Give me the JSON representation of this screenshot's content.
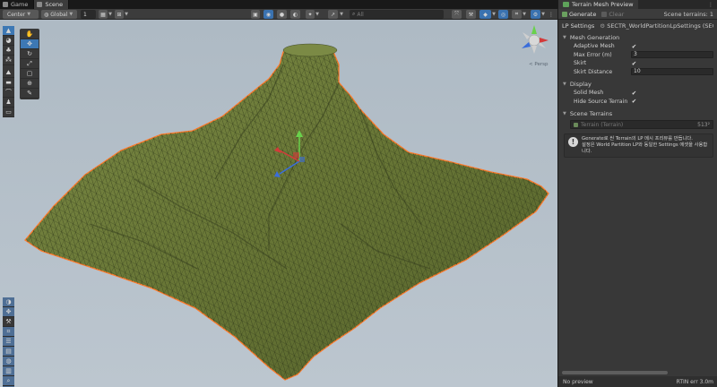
{
  "tabs": [
    {
      "label": "Game",
      "icon": "gamepad-icon"
    },
    {
      "label": "Scene",
      "icon": "scene-grid-icon"
    }
  ],
  "toolbar": {
    "pivot_mode": "Center",
    "pivot_rotation": "Global",
    "grid_snap_value": "1",
    "search_placeholder": "All"
  },
  "viewport": {
    "projection_label": "< Persp",
    "terrain_fill": "#6b7a3a",
    "terrain_outline": "#ff7a2a",
    "sky_color": "#b4bfc9"
  },
  "panel": {
    "title": "Terrain Mesh Preview",
    "generate_label": "Generate",
    "clear_label": "Clear",
    "scene_terrains_count": "Scene terrains: 1",
    "lp_settings_label": "LP Settings",
    "lp_settings_value": "SECTR_WorldPartitionLpSettings (SECTR_World P",
    "mesh_generation": {
      "title": "Mesh Generation",
      "adaptive_mesh_label": "Adaptive Mesh",
      "adaptive_mesh": true,
      "max_error_label": "Max Error (m)",
      "max_error": "3",
      "skirt_label": "Skirt",
      "skirt": true,
      "skirt_distance_label": "Skirt Distance",
      "skirt_distance": "10"
    },
    "display": {
      "title": "Display",
      "solid_mesh_label": "Solid Mesh",
      "solid_mesh": true,
      "hide_source_label": "Hide Source Terrain",
      "hide_source": true
    },
    "scene_terrains": {
      "title": "Scene Terrains",
      "terrain_name": "Terrain (Terrain)",
      "terrain_res": "513²"
    },
    "help_line1": "Generate로 씬 Terrain의 LP 메시 프리뷰를 만듭니다.",
    "help_line2": "설정은 World Partition LP와 동일한 Settings 에셋을 사용합니다.",
    "status_left": "No preview",
    "status_right": "RTIN err 3.0m"
  }
}
